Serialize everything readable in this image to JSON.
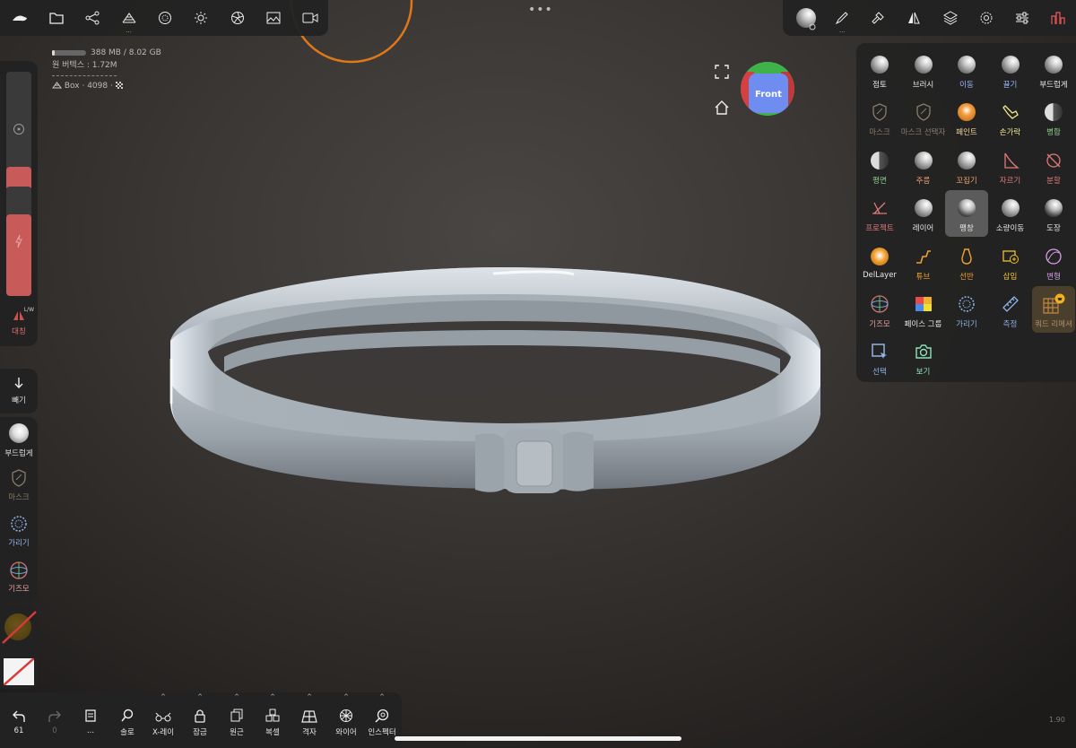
{
  "top_left_toolbar": {
    "icons": [
      "sculpt-app-icon",
      "folder-icon",
      "scene-graph-icon",
      "topology-icon",
      "material-sphere-icon",
      "light-sun-icon",
      "camera-aperture-icon",
      "image-icon",
      "video-icon"
    ]
  },
  "top_right_toolbar": {
    "icons": [
      "matcap-icon",
      "brush-stroke-icon",
      "hammer-icon",
      "symmetry-icon",
      "layers-icon",
      "settings-icon",
      "sliders-icon",
      "tools-icon"
    ]
  },
  "info": {
    "memory": "388 MB / 8.02 GB",
    "vertices": "원 버텍스 : 1.72M",
    "object": "Box · 4098 ·"
  },
  "left_sliders": {
    "radius_level": 0.2,
    "intensity_level": 0.75,
    "symmetry_badge": "L/W",
    "symmetry_label": "대칭"
  },
  "left_tools": {
    "subtract_label": "빼기",
    "quick_tools": [
      {
        "label": "부드럽게",
        "color": "#e8e8e8"
      },
      {
        "label": "마스크",
        "color": "#8a7d6b"
      },
      {
        "label": "가리기",
        "color": "#8fb4e6"
      },
      {
        "label": "기즈모",
        "color": "#e8a0a0"
      }
    ]
  },
  "viewcube": {
    "label": "Front"
  },
  "tools_grid": [
    {
      "label": "점토",
      "color": "#e8e8e8",
      "icon": "ball"
    },
    {
      "label": "브러시",
      "color": "#e8e8e8",
      "icon": "ball"
    },
    {
      "label": "이동",
      "color": "#9db8ff",
      "icon": "ball"
    },
    {
      "label": "끌기",
      "color": "#9db8ff",
      "icon": "ball"
    },
    {
      "label": "부드럽게",
      "color": "#e8e8e8",
      "icon": "ball"
    },
    {
      "label": "마스크",
      "color": "#8a7d6b",
      "icon": "shield"
    },
    {
      "label": "마스크 선택자",
      "color": "#8a7d6b",
      "icon": "shield"
    },
    {
      "label": "페인트",
      "color": "#f2d39a",
      "icon": "paint"
    },
    {
      "label": "손가락",
      "color": "#f0e68c",
      "icon": "finger"
    },
    {
      "label": "병합",
      "color": "#8fd08f",
      "icon": "half"
    },
    {
      "label": "평면",
      "color": "#8fd08f",
      "icon": "half"
    },
    {
      "label": "주름",
      "color": "#f0a070",
      "icon": "ball"
    },
    {
      "label": "꼬집기",
      "color": "#f0a070",
      "icon": "ball"
    },
    {
      "label": "자르기",
      "color": "#e07a7a",
      "icon": "cut"
    },
    {
      "label": "분할",
      "color": "#e07a7a",
      "icon": "split"
    },
    {
      "label": "프로젝트",
      "color": "#e07a7a",
      "icon": "project"
    },
    {
      "label": "레이어",
      "color": "#e8e8e8",
      "icon": "ball"
    },
    {
      "label": "팽창",
      "color": "#e8e8e8",
      "icon": "dark"
    },
    {
      "label": "소량이동",
      "color": "#e8e8e8",
      "icon": "ball"
    },
    {
      "label": "도장",
      "color": "#e8e8e8",
      "icon": "dark"
    },
    {
      "label": "DelLayer",
      "color": "#e8e8e8",
      "icon": "dellayer"
    },
    {
      "label": "튜브",
      "color": "#f0a030",
      "icon": "tube"
    },
    {
      "label": "선반",
      "color": "#f0a030",
      "icon": "lathe"
    },
    {
      "label": "삽입",
      "color": "#f0c030",
      "icon": "insert"
    },
    {
      "label": "변형",
      "color": "#d8a0e8",
      "icon": "transform"
    },
    {
      "label": "기즈모",
      "color": "#e8a0a0",
      "icon": "gizmo"
    },
    {
      "label": "페이스 그룹",
      "color": "#e8e8e8",
      "icon": "facegroup"
    },
    {
      "label": "가리기",
      "color": "#8fb4e6",
      "icon": "hide"
    },
    {
      "label": "측정",
      "color": "#8fb4e6",
      "icon": "ruler"
    },
    {
      "label": "쿼드 리메셔",
      "color": "#a89070",
      "icon": "quad"
    },
    {
      "label": "선택",
      "color": "#8fb4e6",
      "icon": "select"
    },
    {
      "label": "보기",
      "color": "#8fe0c0",
      "icon": "camera"
    }
  ],
  "bottom_toolbar": [
    {
      "label": "61",
      "icon": "undo"
    },
    {
      "label": "0",
      "icon": "redo"
    },
    {
      "label": "...",
      "icon": "doc"
    },
    {
      "label": "솔로",
      "icon": "solo"
    },
    {
      "label": "X-레이",
      "icon": "xray"
    },
    {
      "label": "잠금",
      "icon": "lock"
    },
    {
      "label": "원근",
      "icon": "persp"
    },
    {
      "label": "복셀",
      "icon": "voxel"
    },
    {
      "label": "격자",
      "icon": "grid"
    },
    {
      "label": "와이어",
      "icon": "wire"
    },
    {
      "label": "인스펙터",
      "icon": "inspect"
    }
  ],
  "version": "1.90"
}
